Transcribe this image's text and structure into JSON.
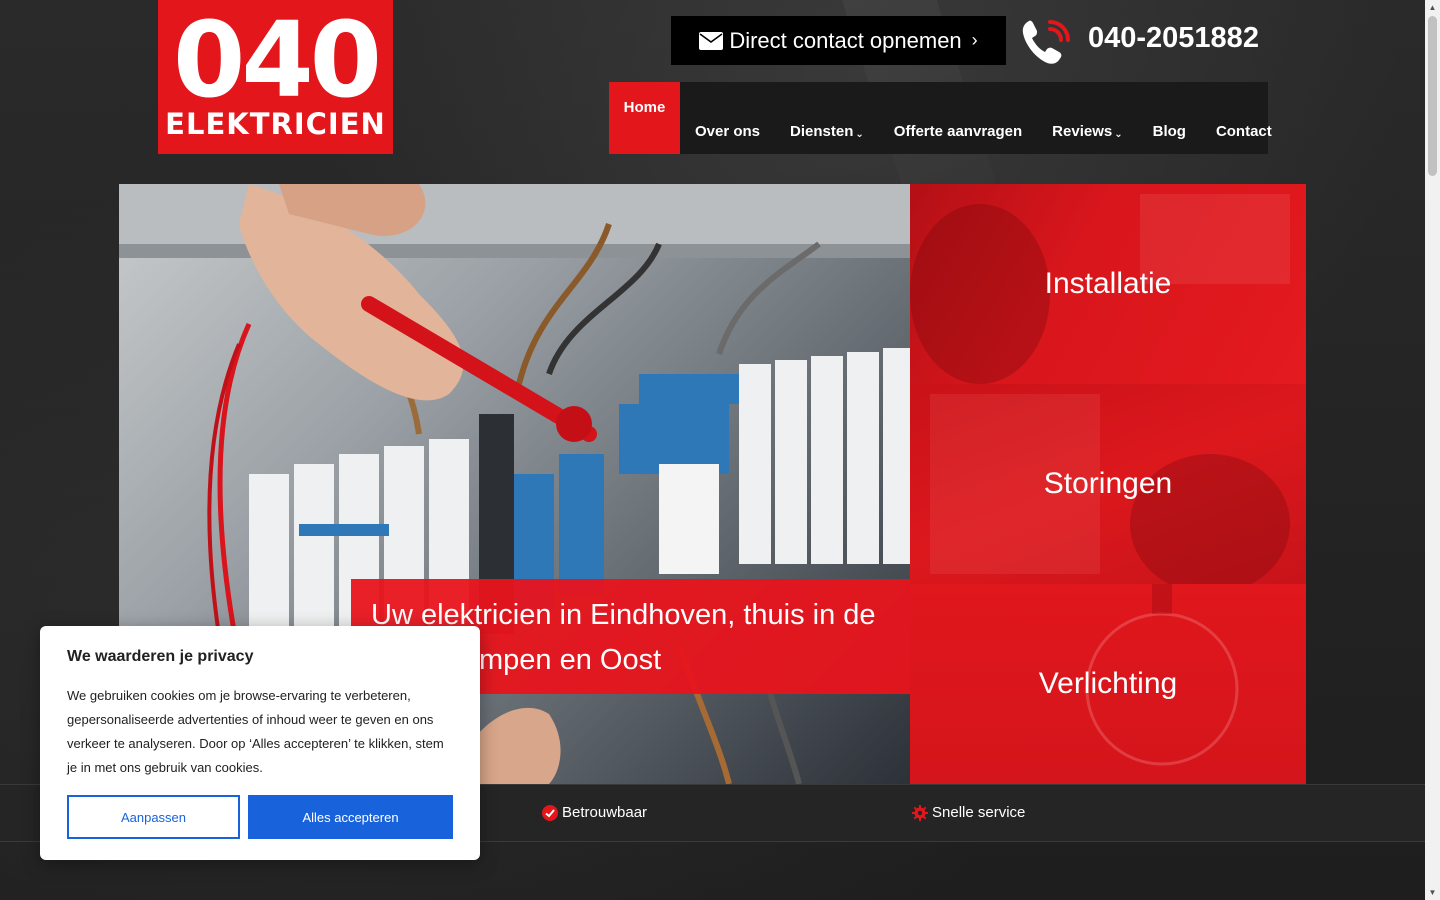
{
  "logo": {
    "number": "040",
    "word": "ELEKTRICIEN"
  },
  "header": {
    "contact_button_label": "Direct contact opnemen",
    "contact_button_chevron": "›",
    "phone": "040-2051882"
  },
  "nav": {
    "items": [
      {
        "label": "Home",
        "active": true
      },
      {
        "label": "Over ons"
      },
      {
        "label": "Diensten",
        "dropdown": true
      },
      {
        "label": "Offerte aanvragen"
      },
      {
        "label": "Reviews",
        "dropdown": true
      },
      {
        "label": "Blog"
      },
      {
        "label": "Contact"
      }
    ]
  },
  "hero": {
    "caption": "Uw elektricien in Eindhoven, thuis in de regio Kempen en Oost"
  },
  "tiles": [
    {
      "label": "Installatie"
    },
    {
      "label": "Storingen"
    },
    {
      "label": "Verlichting"
    }
  ],
  "features": [
    {
      "label": "Betrouwbaar",
      "icon": "check-circle-icon"
    },
    {
      "label": "Snelle service",
      "icon": "gear-icon"
    }
  ],
  "cookie": {
    "title": "We waarderen je privacy",
    "text": "We gebruiken cookies om je browse-ervaring te verbeteren, gepersonaliseerde advertenties of inhoud weer te geven en ons verkeer te analyseren. Door op ‘Alles accepteren’ te klikken, stem je in met ons gebruik van cookies.",
    "customize_label": "Aanpassen",
    "accept_label": "Alles accepteren"
  },
  "colors": {
    "brand_red": "#e3161b",
    "cookie_blue": "#1863dc",
    "dark_bg": "#232323"
  }
}
